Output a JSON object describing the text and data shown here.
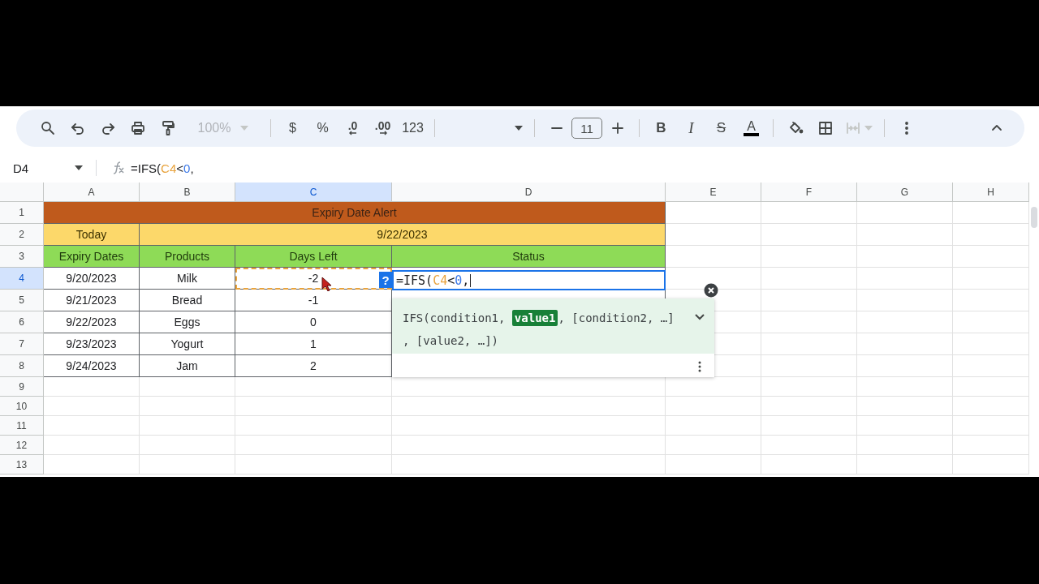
{
  "toolbar": {
    "zoom": {
      "value": "100%",
      "disabled": true
    },
    "currency": "$",
    "percent": "%",
    "decimal_decrease": ".0",
    "decimal_increase": ".00",
    "number_format": "123",
    "font_size": "11",
    "bold": "B",
    "italic": "I",
    "strikethrough": "S",
    "text_color": "A",
    "merge_disabled": true
  },
  "formula_bar": {
    "name_box": "D4",
    "formula": [
      {
        "text": "=IFS(",
        "kind": "plain"
      },
      {
        "text": "C4",
        "kind": "ref"
      },
      {
        "text": "<",
        "kind": "plain"
      },
      {
        "text": "0",
        "kind": "number"
      },
      {
        "text": ",",
        "kind": "plain"
      }
    ]
  },
  "sheet": {
    "columns": [
      {
        "label": "A",
        "selected": false
      },
      {
        "label": "B",
        "selected": false
      },
      {
        "label": "C",
        "selected": true
      },
      {
        "label": "D",
        "selected": false
      },
      {
        "label": "E",
        "selected": false
      },
      {
        "label": "F",
        "selected": false
      },
      {
        "label": "G",
        "selected": false
      },
      {
        "label": "H",
        "selected": false
      }
    ],
    "rows": [
      {
        "label": "1",
        "selected": false
      },
      {
        "label": "2",
        "selected": false
      },
      {
        "label": "3",
        "selected": false
      },
      {
        "label": "4",
        "selected": true
      },
      {
        "label": "5",
        "selected": false
      },
      {
        "label": "6",
        "selected": false
      },
      {
        "label": "7",
        "selected": false
      },
      {
        "label": "8",
        "selected": false
      },
      {
        "label": "9",
        "selected": false
      },
      {
        "label": "10",
        "selected": false
      },
      {
        "label": "11",
        "selected": false
      },
      {
        "label": "12",
        "selected": false
      },
      {
        "label": "13",
        "selected": false
      }
    ],
    "title": "Expiry Date Alert",
    "today_label": "Today",
    "today_value": "9/22/2023",
    "headers": [
      "Expiry Dates",
      "Products",
      "Days Left",
      "Status"
    ],
    "items": [
      {
        "expiry": "9/20/2023",
        "product": "Milk",
        "days_left": "-2",
        "referenced": true
      },
      {
        "expiry": "9/21/2023",
        "product": "Bread",
        "days_left": "-1",
        "referenced": false
      },
      {
        "expiry": "9/22/2023",
        "product": "Eggs",
        "days_left": "0",
        "referenced": false
      },
      {
        "expiry": "9/23/2023",
        "product": "Yogurt",
        "days_left": "1",
        "referenced": false
      },
      {
        "expiry": "9/24/2023",
        "product": "Jam",
        "days_left": "2",
        "referenced": false
      }
    ]
  },
  "editor": {
    "help_badge": "?",
    "formula": [
      {
        "text": "=IFS(",
        "kind": "plain"
      },
      {
        "text": "C4",
        "kind": "ref"
      },
      {
        "text": "<",
        "kind": "plain"
      },
      {
        "text": "0",
        "kind": "number"
      },
      {
        "text": ",",
        "kind": "plain"
      }
    ]
  },
  "hint": {
    "lines": [
      [
        {
          "text": "IFS(condition1, ",
          "highlighted": false
        },
        {
          "text": "value1",
          "highlighted": true
        },
        {
          "text": ", [condition2, …]",
          "highlighted": false
        }
      ],
      [
        {
          "text": ", [value2, …])",
          "highlighted": false
        }
      ]
    ]
  }
}
